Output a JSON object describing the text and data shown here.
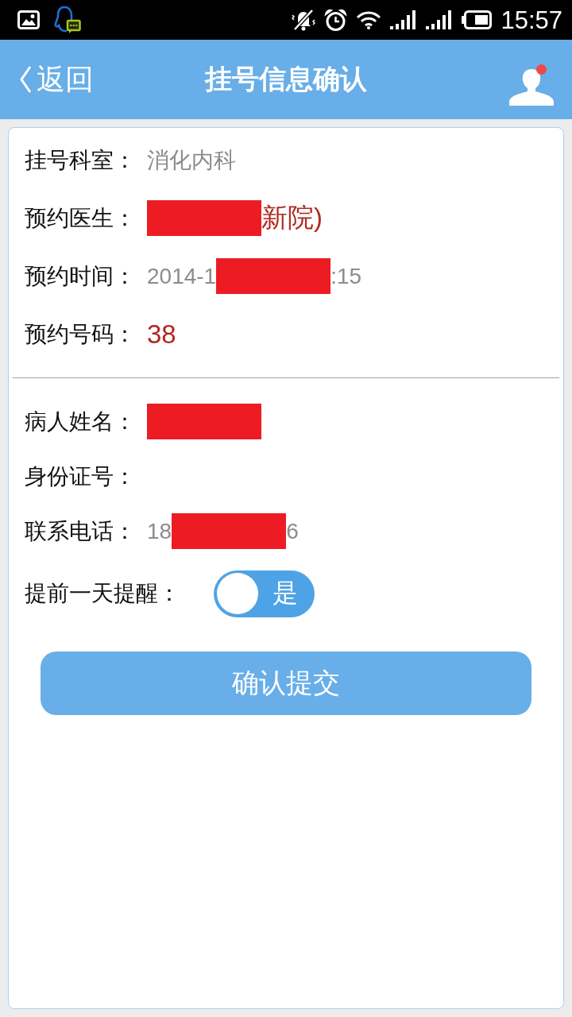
{
  "status_bar": {
    "time": "15:57"
  },
  "header": {
    "back_label": "返回",
    "title": "挂号信息确认",
    "profile_badge": true
  },
  "sections": [
    {
      "rows": [
        {
          "kind": "text",
          "label": "挂号科室：",
          "parts": [
            {
              "kind": "text",
              "text": "消化内科",
              "highlighted": false
            }
          ]
        },
        {
          "kind": "text",
          "label": "预约医生：",
          "parts": [
            {
              "kind": "redacted"
            },
            {
              "kind": "text",
              "text": "新院)",
              "highlighted": true
            }
          ]
        },
        {
          "kind": "text",
          "label": "预约时间：",
          "parts": [
            {
              "kind": "text",
              "text": "2014-1",
              "highlighted": false
            },
            {
              "kind": "redacted"
            },
            {
              "kind": "text",
              "text": ":15",
              "highlighted": false
            }
          ]
        },
        {
          "kind": "text",
          "label": "预约号码：",
          "parts": [
            {
              "kind": "text",
              "text": "38",
              "highlighted": true
            }
          ]
        }
      ]
    },
    {
      "rows": [
        {
          "kind": "text",
          "label": "病人姓名：",
          "parts": [
            {
              "kind": "redacted"
            }
          ]
        },
        {
          "kind": "text",
          "label": "身份证号："
        },
        {
          "kind": "text",
          "label": "联系电话：",
          "parts": [
            {
              "kind": "text",
              "text": "18",
              "highlighted": false
            },
            {
              "kind": "redacted"
            },
            {
              "kind": "text",
              "text": "6",
              "highlighted": false
            }
          ]
        },
        {
          "kind": "toggle",
          "label": "提前一天提醒：",
          "on": true,
          "toggle_label": "是"
        }
      ]
    }
  ],
  "submit": {
    "label": "确认提交"
  }
}
